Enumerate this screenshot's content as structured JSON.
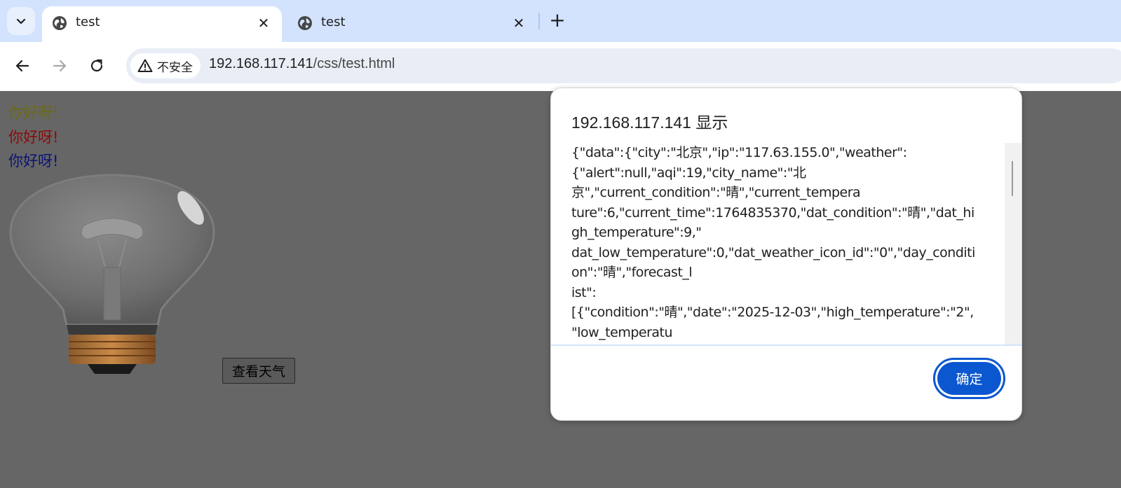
{
  "browser": {
    "tabs": [
      {
        "title": "test",
        "icon": "globe-icon",
        "active": true
      },
      {
        "title": "test",
        "icon": "globe-icon",
        "active": false
      }
    ],
    "new_tab_label": "+",
    "security_label": "不安全",
    "url_host": "192.168.117.141",
    "url_path": "/css/test.html"
  },
  "page": {
    "greetings": [
      {
        "text": "你好呀!",
        "color": "#6b6b14"
      },
      {
        "text": "你好呀!",
        "color": "#8b0a0a"
      },
      {
        "text": "你好呀!",
        "color": "#0b1474"
      }
    ],
    "weather_button_label": "查看天气"
  },
  "dialog": {
    "title": "192.168.117.141 显示",
    "message_lines": [
      "{\"data\":{\"city\":\"北京\",\"ip\":\"117.63.155.0\",\"weather\":",
      "{\"alert\":null,\"aqi\":19,\"city_name\":\"北",
      "京\",\"current_condition\":\"晴\",\"current_tempera",
      "ture\":6,\"current_time\":1764835370,\"dat_condition\":\"晴\",\"dat_hi",
      "gh_temperature\":9,\"",
      "dat_low_temperature\":0,\"dat_weather_icon_id\":\"0\",\"day_conditi",
      "on\":\"晴\",\"forecast_l",
      "ist\":",
      "[{\"condition\":\"晴\",\"date\":\"2025-12-03\",\"high_temperature\":\"2\",",
      "\"low_temperatu"
    ],
    "ok_label": "确定",
    "accent_color": "#0b57d0"
  }
}
